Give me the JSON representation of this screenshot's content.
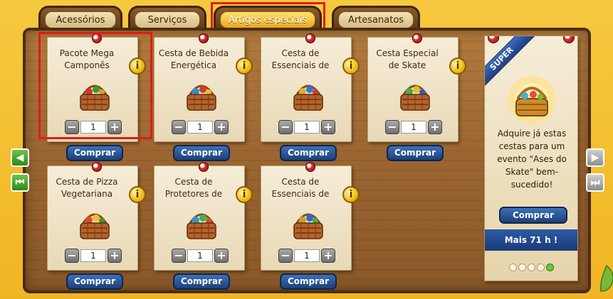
{
  "tabs": [
    {
      "label": "Acessórios"
    },
    {
      "label": "Serviços"
    },
    {
      "label": "Artigos especiais",
      "active": true
    },
    {
      "label": "Artesanatos"
    }
  ],
  "products": [
    {
      "title": "Pacote Mega Camponês",
      "qty": "1",
      "buy": "Comprar",
      "info": "i"
    },
    {
      "title": "Cesta de Bebida Energética",
      "qty": "1",
      "buy": "Comprar",
      "info": "i"
    },
    {
      "title": "Cesta de Essenciais de Ska...",
      "qty": "1",
      "buy": "Comprar",
      "info": "i"
    },
    {
      "title": "Cesta Especial de Skate",
      "qty": "1",
      "buy": "Comprar",
      "info": "i"
    },
    {
      "title": "Cesta de Pizza Vegetariana",
      "qty": "1",
      "buy": "Comprar",
      "info": "i"
    },
    {
      "title": "Cesta de Protetores de Pul...",
      "qty": "1",
      "buy": "Comprar",
      "info": "i"
    },
    {
      "title": "Cesta de Essenciais de Tar...",
      "qty": "1",
      "buy": "Comprar",
      "info": "i"
    }
  ],
  "stepper": {
    "minus": "−",
    "plus": "+"
  },
  "promo": {
    "ribbon": "SUPER",
    "text": "Adquire já estas cestas para um evento \"Ases do Skate\" bem-sucedido!",
    "buy": "Comprar",
    "timer": "Mais 71 h !",
    "page_count": 5,
    "active_page": 5
  },
  "nav": {
    "prev": "◀",
    "first": "⏮",
    "next": "▶",
    "last": "⏭"
  },
  "colors": {
    "accent_blue": "#1d3f79",
    "highlight_red": "#e21a1a",
    "wood": "#9a6531"
  }
}
